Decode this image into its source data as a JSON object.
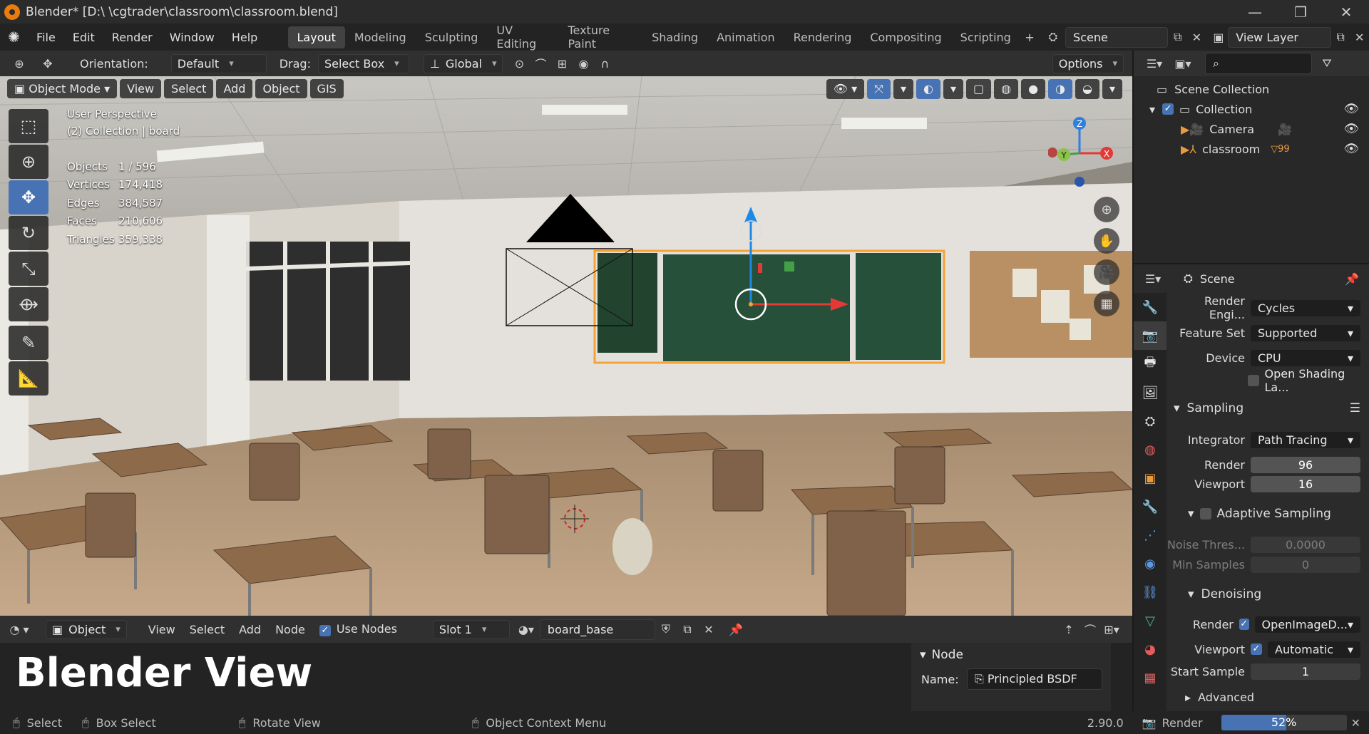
{
  "window": {
    "title": "Blender* [D:\\        \\cgtrader\\classroom\\classroom.blend]",
    "minimize": "—",
    "restore": "❐",
    "close": "✕"
  },
  "menu": [
    "File",
    "Edit",
    "Render",
    "Window",
    "Help"
  ],
  "workspaces": [
    "Layout",
    "Modeling",
    "Sculpting",
    "UV Editing",
    "Texture Paint",
    "Shading",
    "Animation",
    "Rendering",
    "Compositing",
    "Scripting"
  ],
  "active_workspace": "Layout",
  "scene_field": "Scene",
  "view_layer_field": "View Layer",
  "toolheader": {
    "orientation_label": "Orientation:",
    "orientation_value": "Default",
    "drag_label": "Drag:",
    "drag_value": "Select Box",
    "transform_value": "Global",
    "options_label": "Options"
  },
  "viewport": {
    "mode": "Object Mode",
    "menus": [
      "View",
      "Select",
      "Add",
      "Object",
      "GIS"
    ],
    "perspective": "User Perspective",
    "collection_info": "(2) Collection | board",
    "stats": [
      {
        "key": "Objects",
        "value": "1 / 596"
      },
      {
        "key": "Vertices",
        "value": "174,418"
      },
      {
        "key": "Edges",
        "value": "384,587"
      },
      {
        "key": "Faces",
        "value": "210,606"
      },
      {
        "key": "Triangles",
        "value": "359,338"
      }
    ],
    "gizmo_axes": {
      "x": "X",
      "y": "Y",
      "z": "Z"
    }
  },
  "shader_editor": {
    "editor_type": "Object",
    "menus": [
      "View",
      "Select",
      "Add",
      "Node"
    ],
    "use_nodes_label": "Use Nodes",
    "slot": "Slot 1",
    "material": "board_base",
    "overlay_text": "Blender View",
    "node_panel": {
      "title": "Node",
      "name_label": "Name:",
      "name_value": "Principled BSDF"
    }
  },
  "statusbar": {
    "select": "Select",
    "box_select": "Box Select",
    "rotate_view": "Rotate View",
    "context_menu": "Object Context Menu",
    "version": "2.90.0",
    "render_label": "Render",
    "progress_text": "52%",
    "progress_fraction": 0.52
  },
  "outliner": {
    "root": "Scene Collection",
    "collection": "Collection",
    "items": [
      "Camera",
      "classroom"
    ],
    "classroom_badge": "99"
  },
  "properties": {
    "context": "Scene",
    "render_engine_label": "Render Engi...",
    "render_engine": "Cycles",
    "feature_set_label": "Feature Set",
    "feature_set": "Supported",
    "device_label": "Device",
    "device": "CPU",
    "open_shading": "Open Shading La...",
    "sampling_label": "Sampling",
    "integrator_label": "Integrator",
    "integrator": "Path Tracing",
    "render_samples_label": "Render",
    "render_samples": "96",
    "viewport_samples_label": "Viewport",
    "viewport_samples": "16",
    "adaptive_label": "Adaptive Sampling",
    "noise_label": "Noise Thres...",
    "noise_value": "0.0000",
    "min_samples_label": "Min Samples",
    "min_samples_value": "0",
    "denoising_label": "Denoising",
    "denoise_render_label": "Render",
    "denoise_render_value": "OpenImageD...",
    "denoise_viewport_label": "Viewport",
    "denoise_viewport_value": "Automatic",
    "start_sample_label": "Start Sample",
    "start_sample_value": "1",
    "advanced_label": "Advanced"
  },
  "colors": {
    "accent": "#4772b3",
    "selection_orange": "#f5a236",
    "progress": "#4772b3"
  }
}
